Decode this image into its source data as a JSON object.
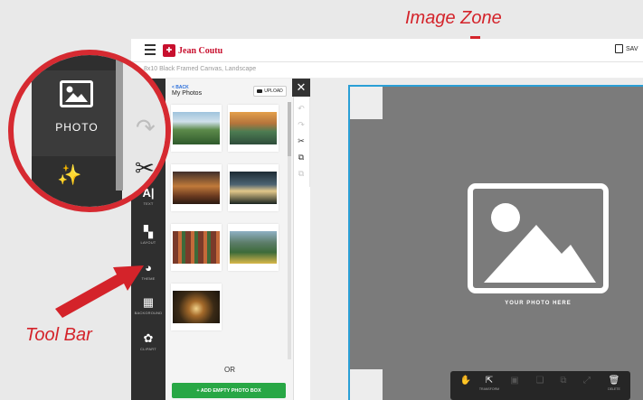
{
  "annotations": {
    "image_zone": "Image Zone",
    "tool_bar": "Tool Bar"
  },
  "header": {
    "brand": "Jean Coutu",
    "save_label": "SAV",
    "product_title": "8x10 Black Framed Canvas, Landscape"
  },
  "toolbar": {
    "items": [
      {
        "label": "TEXT",
        "icon": "text-icon"
      },
      {
        "label": "LAYOUT",
        "icon": "layout-icon"
      },
      {
        "label": "THEME",
        "icon": "palette-icon"
      },
      {
        "label": "BACKGROUND",
        "icon": "background-icon"
      },
      {
        "label": "CLIPART",
        "icon": "flower-icon"
      }
    ]
  },
  "zoom": {
    "photo_label": "PHOTO"
  },
  "photos_panel": {
    "back_label": "< BACK",
    "title": "My Photos",
    "upload_label": "UPLOAD",
    "or_label": "OR",
    "add_empty_label": "+   ADD EMPTY PHOTO BOX"
  },
  "canvas": {
    "placeholder_text": "YOUR PHOTO HERE",
    "zone_border_color": "#2a9fd6",
    "zone_fill_color": "#7b7b7b"
  },
  "bottom_bar": {
    "items": [
      {
        "label": "",
        "icon": "hand-icon"
      },
      {
        "label": "TRANSFORM",
        "icon": "transform-icon"
      },
      {
        "label": "",
        "icon": "image-icon"
      },
      {
        "label": "",
        "icon": "layers-icon"
      },
      {
        "label": "",
        "icon": "copy-icon"
      },
      {
        "label": "",
        "icon": "resize-icon"
      },
      {
        "label": "DELETE",
        "icon": "trash-icon"
      }
    ]
  },
  "colors": {
    "accent_red": "#d62a31",
    "add_green": "#28a745",
    "toolbar_dark": "#2f2f2f"
  }
}
